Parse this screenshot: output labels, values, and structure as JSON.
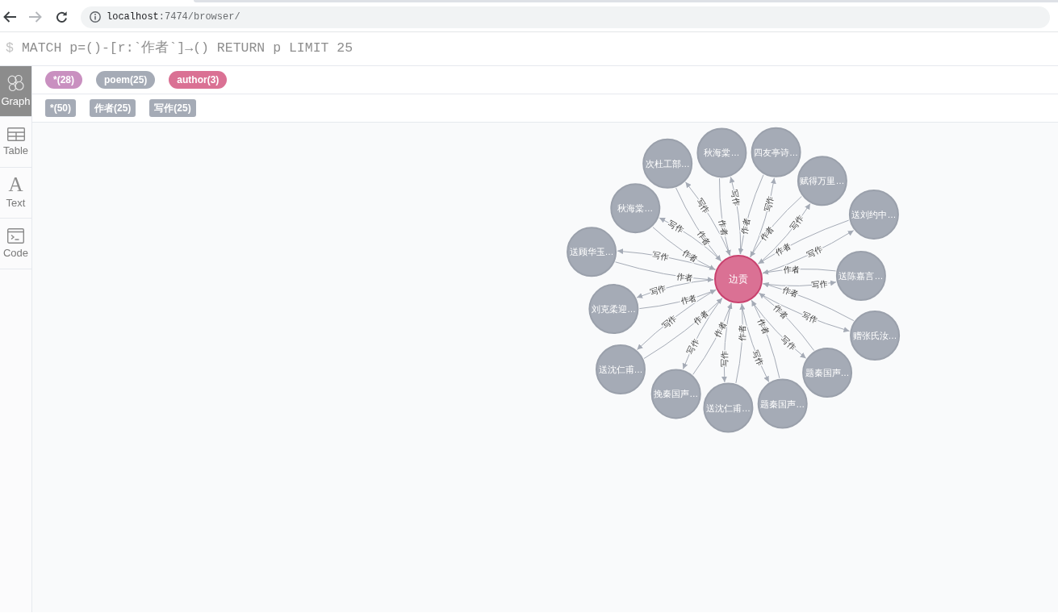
{
  "browser": {
    "back": {
      "disabled": false
    },
    "forward": {
      "disabled": true
    },
    "address": {
      "host": "localhost",
      "path": ":7474/browser/"
    }
  },
  "editor": {
    "prompt": "$",
    "query": "MATCH p=()-[r:`作者`]→() RETURN p LIMIT 25"
  },
  "sidebar": {
    "tabs": [
      {
        "label": "Graph",
        "kind": "graph",
        "selected": true
      },
      {
        "label": "Table",
        "kind": "table",
        "selected": false
      },
      {
        "label": "Text",
        "kind": "text",
        "glyph": "A",
        "selected": false
      },
      {
        "label": "Code",
        "kind": "code",
        "selected": false
      }
    ]
  },
  "legend": {
    "node_labels": [
      {
        "label": "*(28)",
        "color": "#c990c0"
      },
      {
        "label": "poem(25)",
        "color": "#a5abb6"
      },
      {
        "label": "author(3)",
        "color": "#da7194"
      }
    ],
    "relationship_types": [
      {
        "label": "*(50)"
      },
      {
        "label": "作者(25)"
      },
      {
        "label": "写作(25)"
      }
    ]
  },
  "graph": {
    "center": {
      "label": "边贡",
      "color": "#da7194"
    },
    "nodes": [
      {
        "label": "次杜工部…",
        "color": "#a5abb6",
        "edges": [
          {
            "label": "作者",
            "toward_center": true
          },
          {
            "label": "写作",
            "toward_center": false
          }
        ]
      },
      {
        "label": "秋海棠…",
        "color": "#a5abb6",
        "edges": [
          {
            "label": "作者",
            "toward_center": true
          },
          {
            "label": "写作",
            "toward_center": false
          }
        ]
      },
      {
        "label": "四友亭诗…",
        "color": "#a5abb6",
        "edges": [
          {
            "label": "作者",
            "toward_center": true
          },
          {
            "label": "写作",
            "toward_center": false
          }
        ]
      },
      {
        "label": "赋得万里…",
        "color": "#a5abb6",
        "edges": [
          {
            "label": "作者",
            "toward_center": true
          },
          {
            "label": "写作",
            "toward_center": false
          }
        ]
      },
      {
        "label": "秋海棠…",
        "color": "#a5abb6",
        "edges": [
          {
            "label": "作者",
            "toward_center": true
          },
          {
            "label": "写作",
            "toward_center": false
          }
        ]
      },
      {
        "label": "送刘约中…",
        "color": "#a5abb6",
        "edges": [
          {
            "label": "作者",
            "toward_center": true
          },
          {
            "label": "写作",
            "toward_center": false
          }
        ]
      },
      {
        "label": "送顾华玉…",
        "color": "#a5abb6",
        "edges": [
          {
            "label": "作者",
            "toward_center": true
          },
          {
            "label": "写作",
            "toward_center": false
          }
        ]
      },
      {
        "label": "送陈嘉言…",
        "color": "#a5abb6",
        "edges": [
          {
            "label": "作者",
            "toward_center": true
          },
          {
            "label": "写作",
            "toward_center": false
          }
        ]
      },
      {
        "label": "刘克柔迎…",
        "color": "#a5abb6",
        "edges": [
          {
            "label": "作者",
            "toward_center": true
          },
          {
            "label": "写作",
            "toward_center": false
          }
        ]
      },
      {
        "label": "赠张氏汝…",
        "color": "#a5abb6",
        "edges": [
          {
            "label": "作者",
            "toward_center": true
          },
          {
            "label": "写作",
            "toward_center": false
          }
        ]
      },
      {
        "label": "送沈仁甫…",
        "color": "#a5abb6",
        "edges": [
          {
            "label": "作者",
            "toward_center": true
          },
          {
            "label": "写作",
            "toward_center": false
          }
        ]
      },
      {
        "label": "题秦国声…",
        "color": "#a5abb6",
        "edges": [
          {
            "label": "作者",
            "toward_center": true
          },
          {
            "label": "写作",
            "toward_center": false
          }
        ]
      },
      {
        "label": "挽秦国声…",
        "color": "#a5abb6",
        "edges": [
          {
            "label": "作者",
            "toward_center": true
          },
          {
            "label": "写作",
            "toward_center": false
          }
        ]
      },
      {
        "label": "送沈仁甫…",
        "color": "#a5abb6",
        "edges": [
          {
            "label": "作者",
            "toward_center": true
          },
          {
            "label": "写作",
            "toward_center": false
          }
        ]
      },
      {
        "label": "题秦国声…",
        "color": "#a5abb6",
        "edges": [
          {
            "label": "作者",
            "toward_center": true
          },
          {
            "label": "写作",
            "toward_center": false
          }
        ]
      }
    ]
  }
}
